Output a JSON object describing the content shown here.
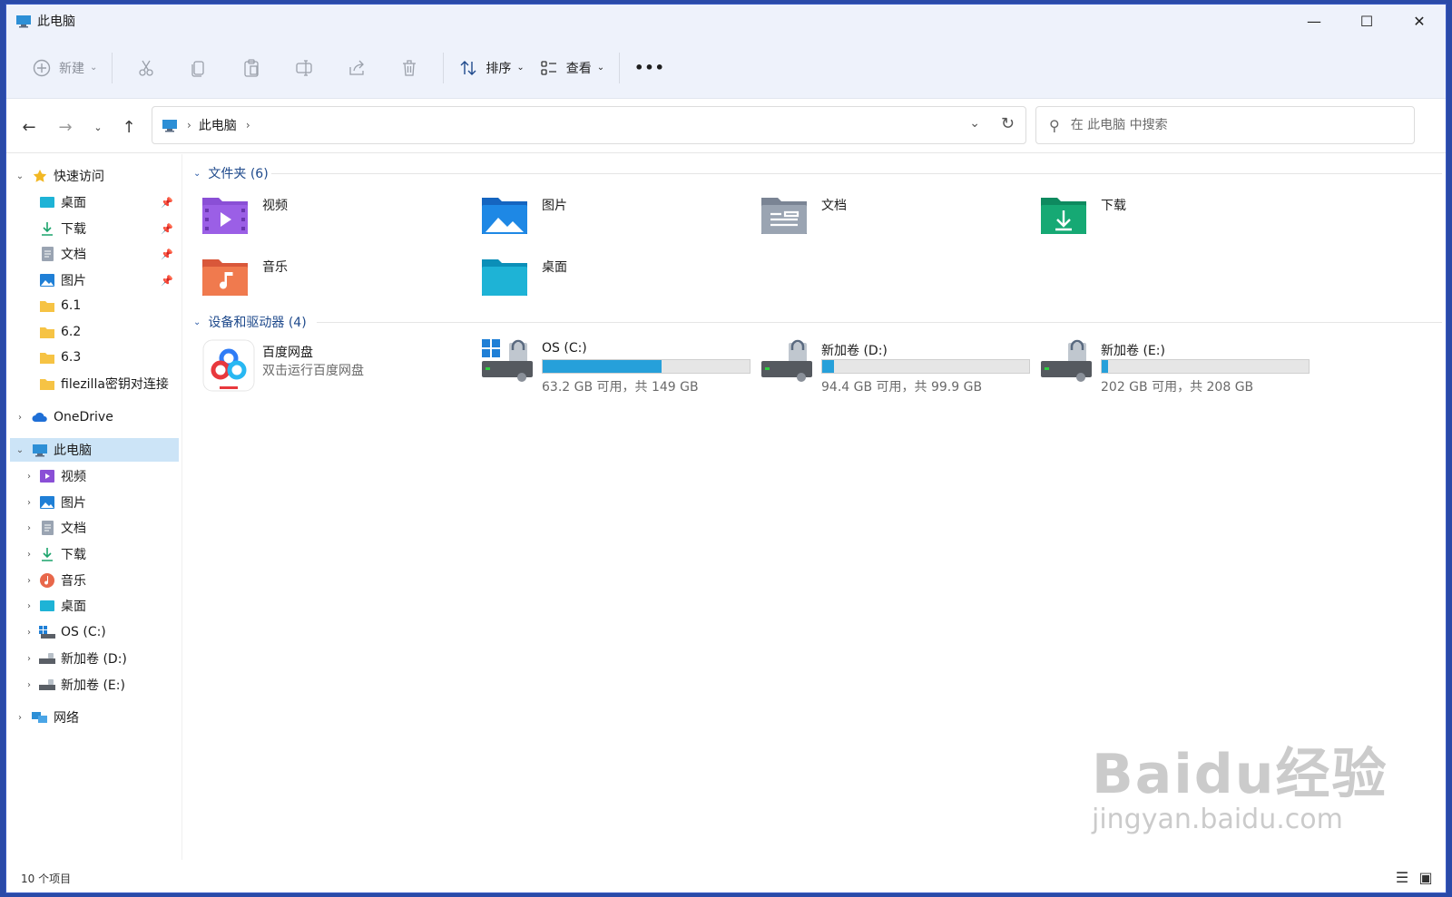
{
  "window": {
    "title": "此电脑"
  },
  "toolbar": {
    "new_label": "新建",
    "sort_label": "排序",
    "view_label": "查看",
    "more_label": "•••"
  },
  "address": {
    "crumb": "此电脑",
    "search_placeholder": "在 此电脑 中搜索"
  },
  "sidebar": {
    "quick_access": "快速访问",
    "quick_items": [
      "桌面",
      "下载",
      "文档",
      "图片",
      "6.1",
      "6.2",
      "6.3",
      "filezilla密钥对连接"
    ],
    "onedrive": "OneDrive",
    "this_pc": "此电脑",
    "pc_items": [
      "视频",
      "图片",
      "文档",
      "下载",
      "音乐",
      "桌面",
      "OS (C:)",
      "新加卷 (D:)",
      "新加卷 (E:)"
    ],
    "network": "网络"
  },
  "folders": {
    "header": "文件夹 (6)",
    "items": [
      "视频",
      "图片",
      "文档",
      "下载",
      "音乐",
      "桌面"
    ]
  },
  "devices": {
    "header": "设备和驱动器 (4)",
    "app": {
      "name": "百度网盘",
      "sub": "双击运行百度网盘"
    },
    "drives": [
      {
        "name": "OS (C:)",
        "sub": "63.2 GB 可用，共 149 GB",
        "used_fraction": 0.576
      },
      {
        "name": "新加卷 (D:)",
        "sub": "94.4 GB 可用，共 99.9 GB",
        "used_fraction": 0.055
      },
      {
        "name": "新加卷 (E:)",
        "sub": "202 GB 可用，共 208 GB",
        "used_fraction": 0.029
      }
    ]
  },
  "status": {
    "count": "10 个项目"
  },
  "watermark": {
    "line1": "Baidu经验",
    "line2": "jingyan.baidu.com"
  },
  "colors": {
    "accent": "#26a0da",
    "selected": "#cce4f7",
    "frame": "#2a4aa8"
  }
}
